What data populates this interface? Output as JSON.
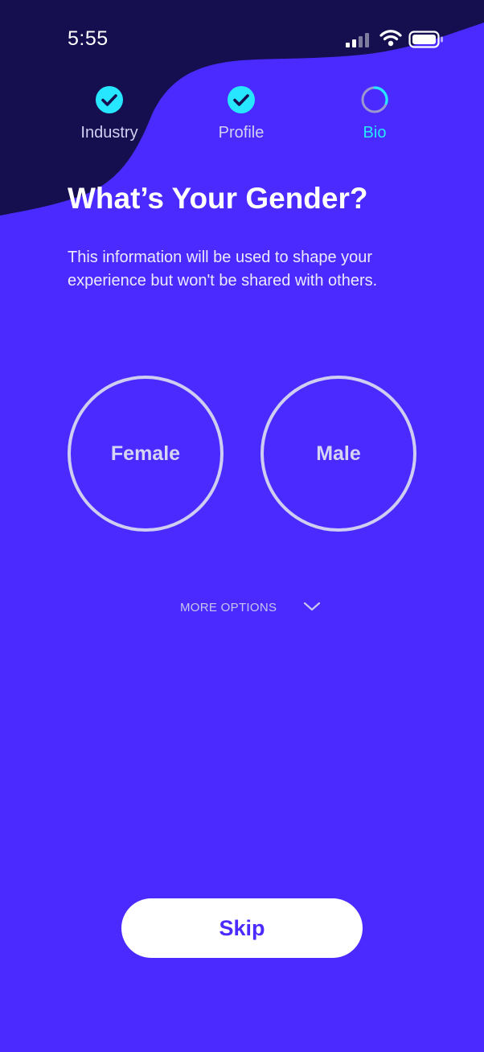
{
  "status_bar": {
    "time": "5:55"
  },
  "stepper": {
    "steps": [
      {
        "label": "Industry",
        "state": "complete",
        "icon": "check-circle-icon"
      },
      {
        "label": "Profile",
        "state": "complete",
        "icon": "check-circle-icon"
      },
      {
        "label": "Bio",
        "state": "in-progress",
        "icon": "progress-ring-icon"
      }
    ]
  },
  "content": {
    "title": "What’s Your Gender?",
    "description": "This information will be used to shape your experience but won't be shared with others.",
    "options": [
      {
        "label": "Female"
      },
      {
        "label": "Male"
      }
    ],
    "more_options_label": "MORE OPTIONS",
    "more_options_icon": "chevron-down-icon"
  },
  "footer": {
    "skip_label": "Skip"
  },
  "colors": {
    "background": "#4a2aff",
    "header_wave": "#150f4f",
    "accent_cyan": "#27e6ff",
    "option_border": "#cfcdf2",
    "button_bg": "#ffffff",
    "button_text": "#4a2aff"
  }
}
